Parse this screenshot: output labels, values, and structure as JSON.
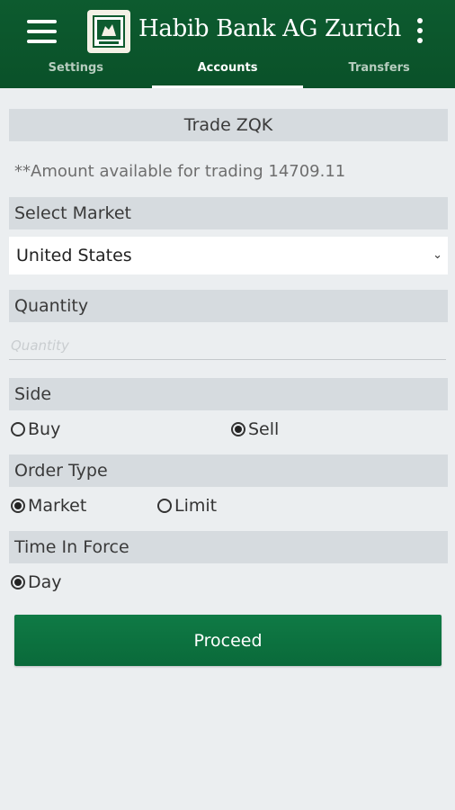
{
  "header": {
    "brand": "Habib Bank AG Zurich",
    "tabs": [
      {
        "label": "Settings",
        "active": false
      },
      {
        "label": "Accounts",
        "active": true
      },
      {
        "label": "Transfers",
        "active": false
      }
    ]
  },
  "trade": {
    "title": "Trade ZQK",
    "available_note": "**Amount available for trading 14709.11",
    "market_label": "Select Market",
    "market_value": "United States",
    "quantity_label": "Quantity",
    "quantity_placeholder": "Quantity",
    "quantity_value": "",
    "side_label": "Side",
    "side_options": [
      "Buy",
      "Sell"
    ],
    "side_selected": "Sell",
    "order_type_label": "Order Type",
    "order_type_options": [
      "Market",
      "Limit"
    ],
    "order_type_selected": "Market",
    "tif_label": "Time In Force",
    "tif_options": [
      "Day"
    ],
    "tif_selected": "Day",
    "proceed_label": "Proceed"
  },
  "colors": {
    "header_green": "#0d5b2f",
    "button_green": "#0f7a45",
    "section_gray": "#d6dbdf",
    "page_bg": "#ebeef0"
  },
  "icons": [
    "hamburger-menu-icon",
    "bank-logo-icon",
    "kebab-menu-icon",
    "chevron-down-icon",
    "radio-icon"
  ]
}
